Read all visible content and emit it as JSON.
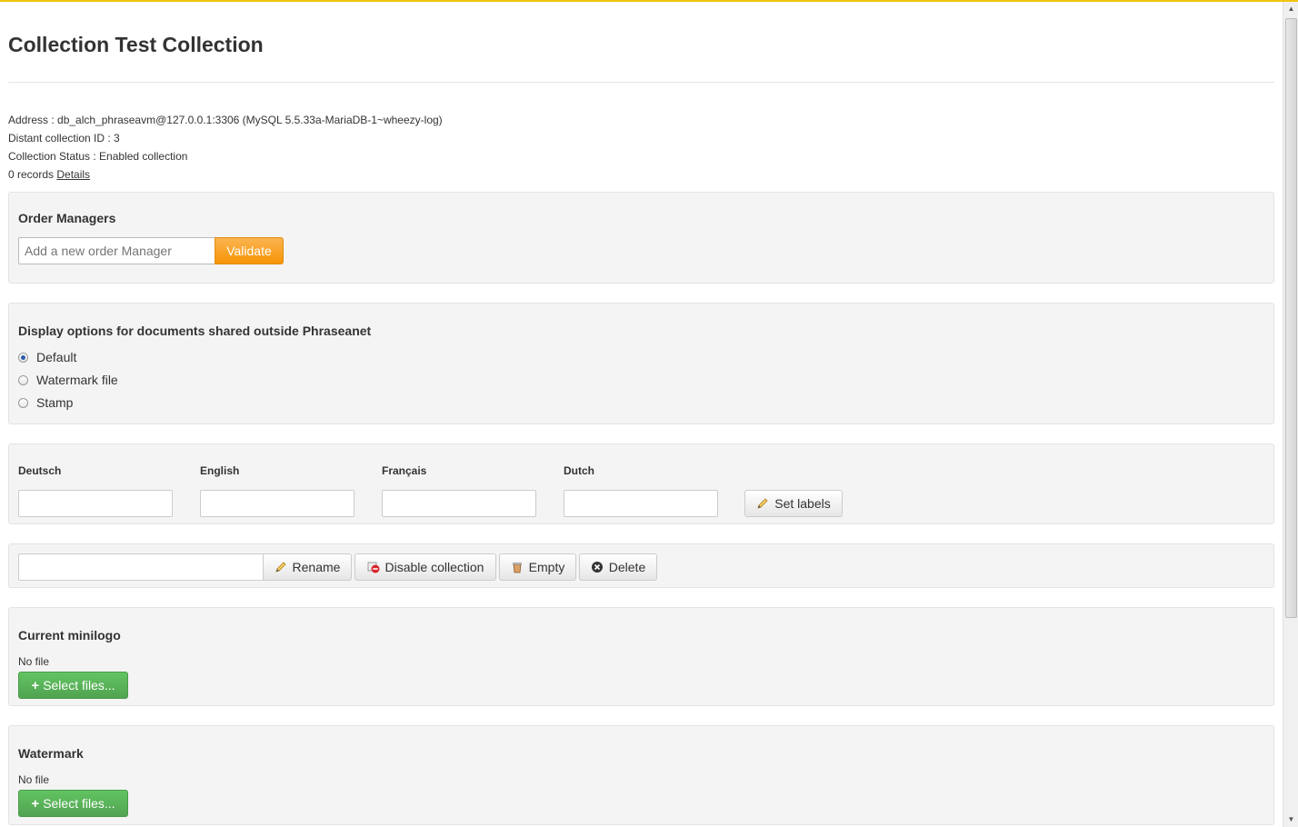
{
  "page": {
    "title": "Collection Test Collection",
    "info": {
      "address": "Address : db_alch_phraseavm@127.0.0.1:3306 (MySQL 5.5.33a-MariaDB-1~wheezy-log)",
      "distant_id": "Distant collection ID : 3",
      "status": "Collection Status : Enabled collection",
      "records": "0 records",
      "details_link": "Details"
    }
  },
  "order_managers": {
    "heading": "Order Managers",
    "input_placeholder": "Add a new order Manager",
    "validate_label": "Validate"
  },
  "display_options": {
    "heading": "Display options for documents shared outside Phraseanet",
    "options": [
      {
        "label": "Default",
        "checked": true
      },
      {
        "label": "Watermark file",
        "checked": false
      },
      {
        "label": "Stamp",
        "checked": false
      }
    ]
  },
  "labels": {
    "languages": [
      "Deutsch",
      "English",
      "Français",
      "Dutch"
    ],
    "set_labels_button": "Set labels"
  },
  "actions": {
    "rename": "Rename",
    "disable": "Disable collection",
    "empty": "Empty",
    "delete": "Delete"
  },
  "minilogo": {
    "heading": "Current minilogo",
    "file_status": "No file",
    "select_button": "Select files..."
  },
  "watermark": {
    "heading": "Watermark",
    "file_status": "No file",
    "select_button": "Select files..."
  },
  "colors": {
    "accent_orange": "#f89406",
    "success_green": "#51a351",
    "top_border": "#f1c40f"
  }
}
